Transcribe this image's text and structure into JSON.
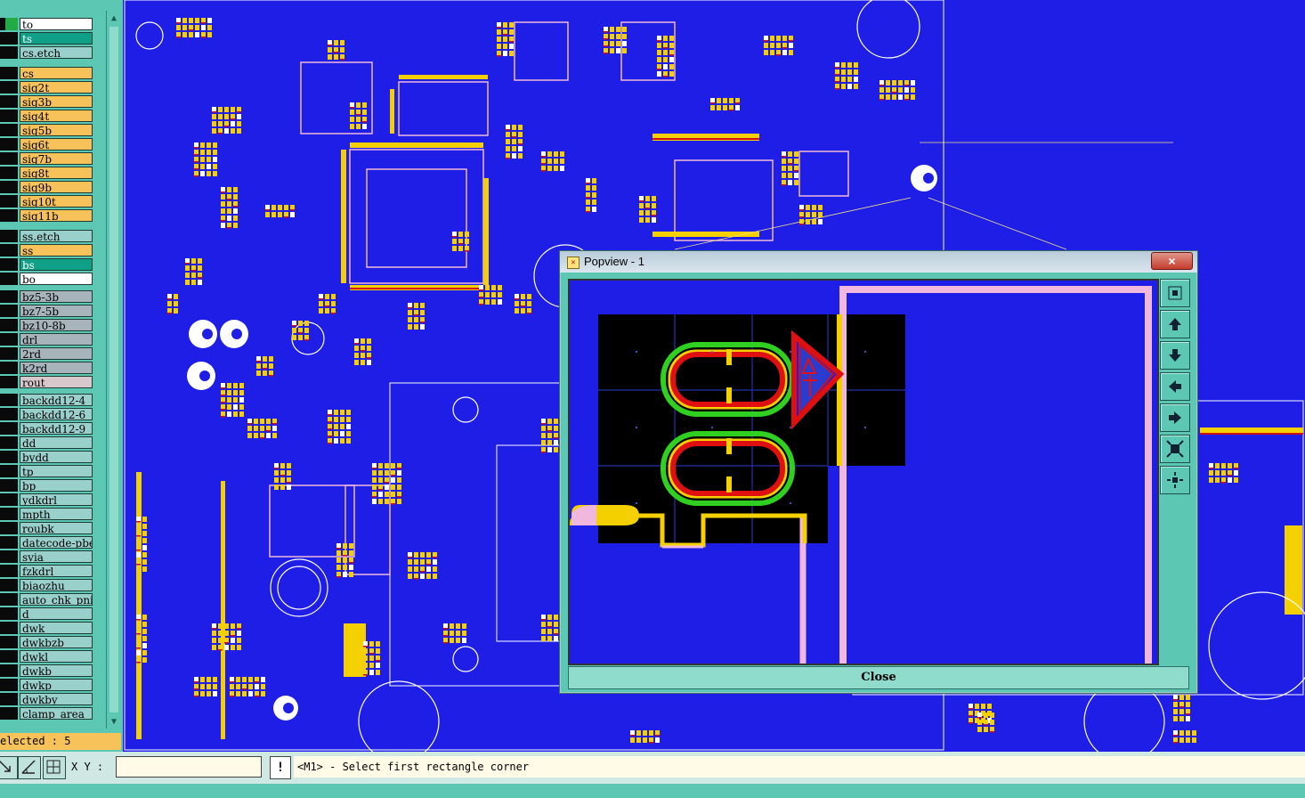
{
  "layer_panel": {
    "top_layer": "to",
    "layers": [
      {
        "name": "ts",
        "kind": "active"
      },
      {
        "name": "cs.etch",
        "kind": "doc"
      },
      {
        "name": "cs",
        "kind": "board"
      },
      {
        "name": "sig2t",
        "kind": "board"
      },
      {
        "name": "sig3b",
        "kind": "board"
      },
      {
        "name": "sig4t",
        "kind": "board"
      },
      {
        "name": "sig5b",
        "kind": "board"
      },
      {
        "name": "sig6t",
        "kind": "board"
      },
      {
        "name": "sig7b",
        "kind": "board"
      },
      {
        "name": "sig8t",
        "kind": "board"
      },
      {
        "name": "sig9b",
        "kind": "board"
      },
      {
        "name": "sig10t",
        "kind": "board"
      },
      {
        "name": "sig11b",
        "kind": "board"
      },
      {
        "name": "ss.etch",
        "kind": "doc"
      },
      {
        "name": "ss",
        "kind": "board"
      },
      {
        "name": "bs",
        "kind": "active"
      },
      {
        "name": "bo",
        "kind": "white"
      },
      {
        "name": "bz5-3b",
        "kind": "misc"
      },
      {
        "name": "bz7-5b",
        "kind": "misc"
      },
      {
        "name": "bz10-8b",
        "kind": "misc"
      },
      {
        "name": "drl",
        "kind": "misc"
      },
      {
        "name": "2rd",
        "kind": "misc"
      },
      {
        "name": "k2rd",
        "kind": "misc"
      },
      {
        "name": "rout",
        "kind": "pink"
      },
      {
        "name": "backdd12-4",
        "kind": "doc"
      },
      {
        "name": "backdd12-6",
        "kind": "doc"
      },
      {
        "name": "backdd12-9",
        "kind": "doc"
      },
      {
        "name": "dd",
        "kind": "doc"
      },
      {
        "name": "bydd",
        "kind": "doc"
      },
      {
        "name": "tp",
        "kind": "doc"
      },
      {
        "name": "bp",
        "kind": "doc"
      },
      {
        "name": "ydkdrl",
        "kind": "doc"
      },
      {
        "name": "mpth",
        "kind": "doc"
      },
      {
        "name": "roubk",
        "kind": "doc"
      },
      {
        "name": "datecode-pbe",
        "kind": "doc"
      },
      {
        "name": "svia",
        "kind": "doc"
      },
      {
        "name": "fzkdrl",
        "kind": "doc"
      },
      {
        "name": "biaozhu",
        "kind": "doc"
      },
      {
        "name": "auto_chk_pni",
        "kind": "doc"
      },
      {
        "name": "d",
        "kind": "doc"
      },
      {
        "name": "dwk",
        "kind": "doc"
      },
      {
        "name": "dwkbzb",
        "kind": "doc"
      },
      {
        "name": "dwkl",
        "kind": "doc"
      },
      {
        "name": "dwkb",
        "kind": "doc"
      },
      {
        "name": "dwkp",
        "kind": "doc"
      },
      {
        "name": "dwkby",
        "kind": "doc"
      },
      {
        "name": "clamp_area",
        "kind": "doc"
      }
    ],
    "selected_status": "elected : 5"
  },
  "popview": {
    "title": "Popview - 1",
    "close_label": "Close",
    "close_x": "×",
    "tools": [
      "zoom-home-icon",
      "zoom-in-icon",
      "zoom-out-icon",
      "pan-left-icon",
      "pan-right-icon",
      "zoom-fit-icon",
      "zoom-center-icon"
    ]
  },
  "command_bar": {
    "xy_label": "X Y :",
    "xy_value": "",
    "warn_label": "!",
    "prompt": "<M1> - Select first rectangle corner"
  },
  "colors": {
    "board_bg": "#1e1ee6",
    "panel": "#5cc8b4",
    "trace_yellow": "#f5d000",
    "outline_pink": "#f0b8dc",
    "pad_red": "#e01010",
    "pad_green": "#30d020"
  }
}
